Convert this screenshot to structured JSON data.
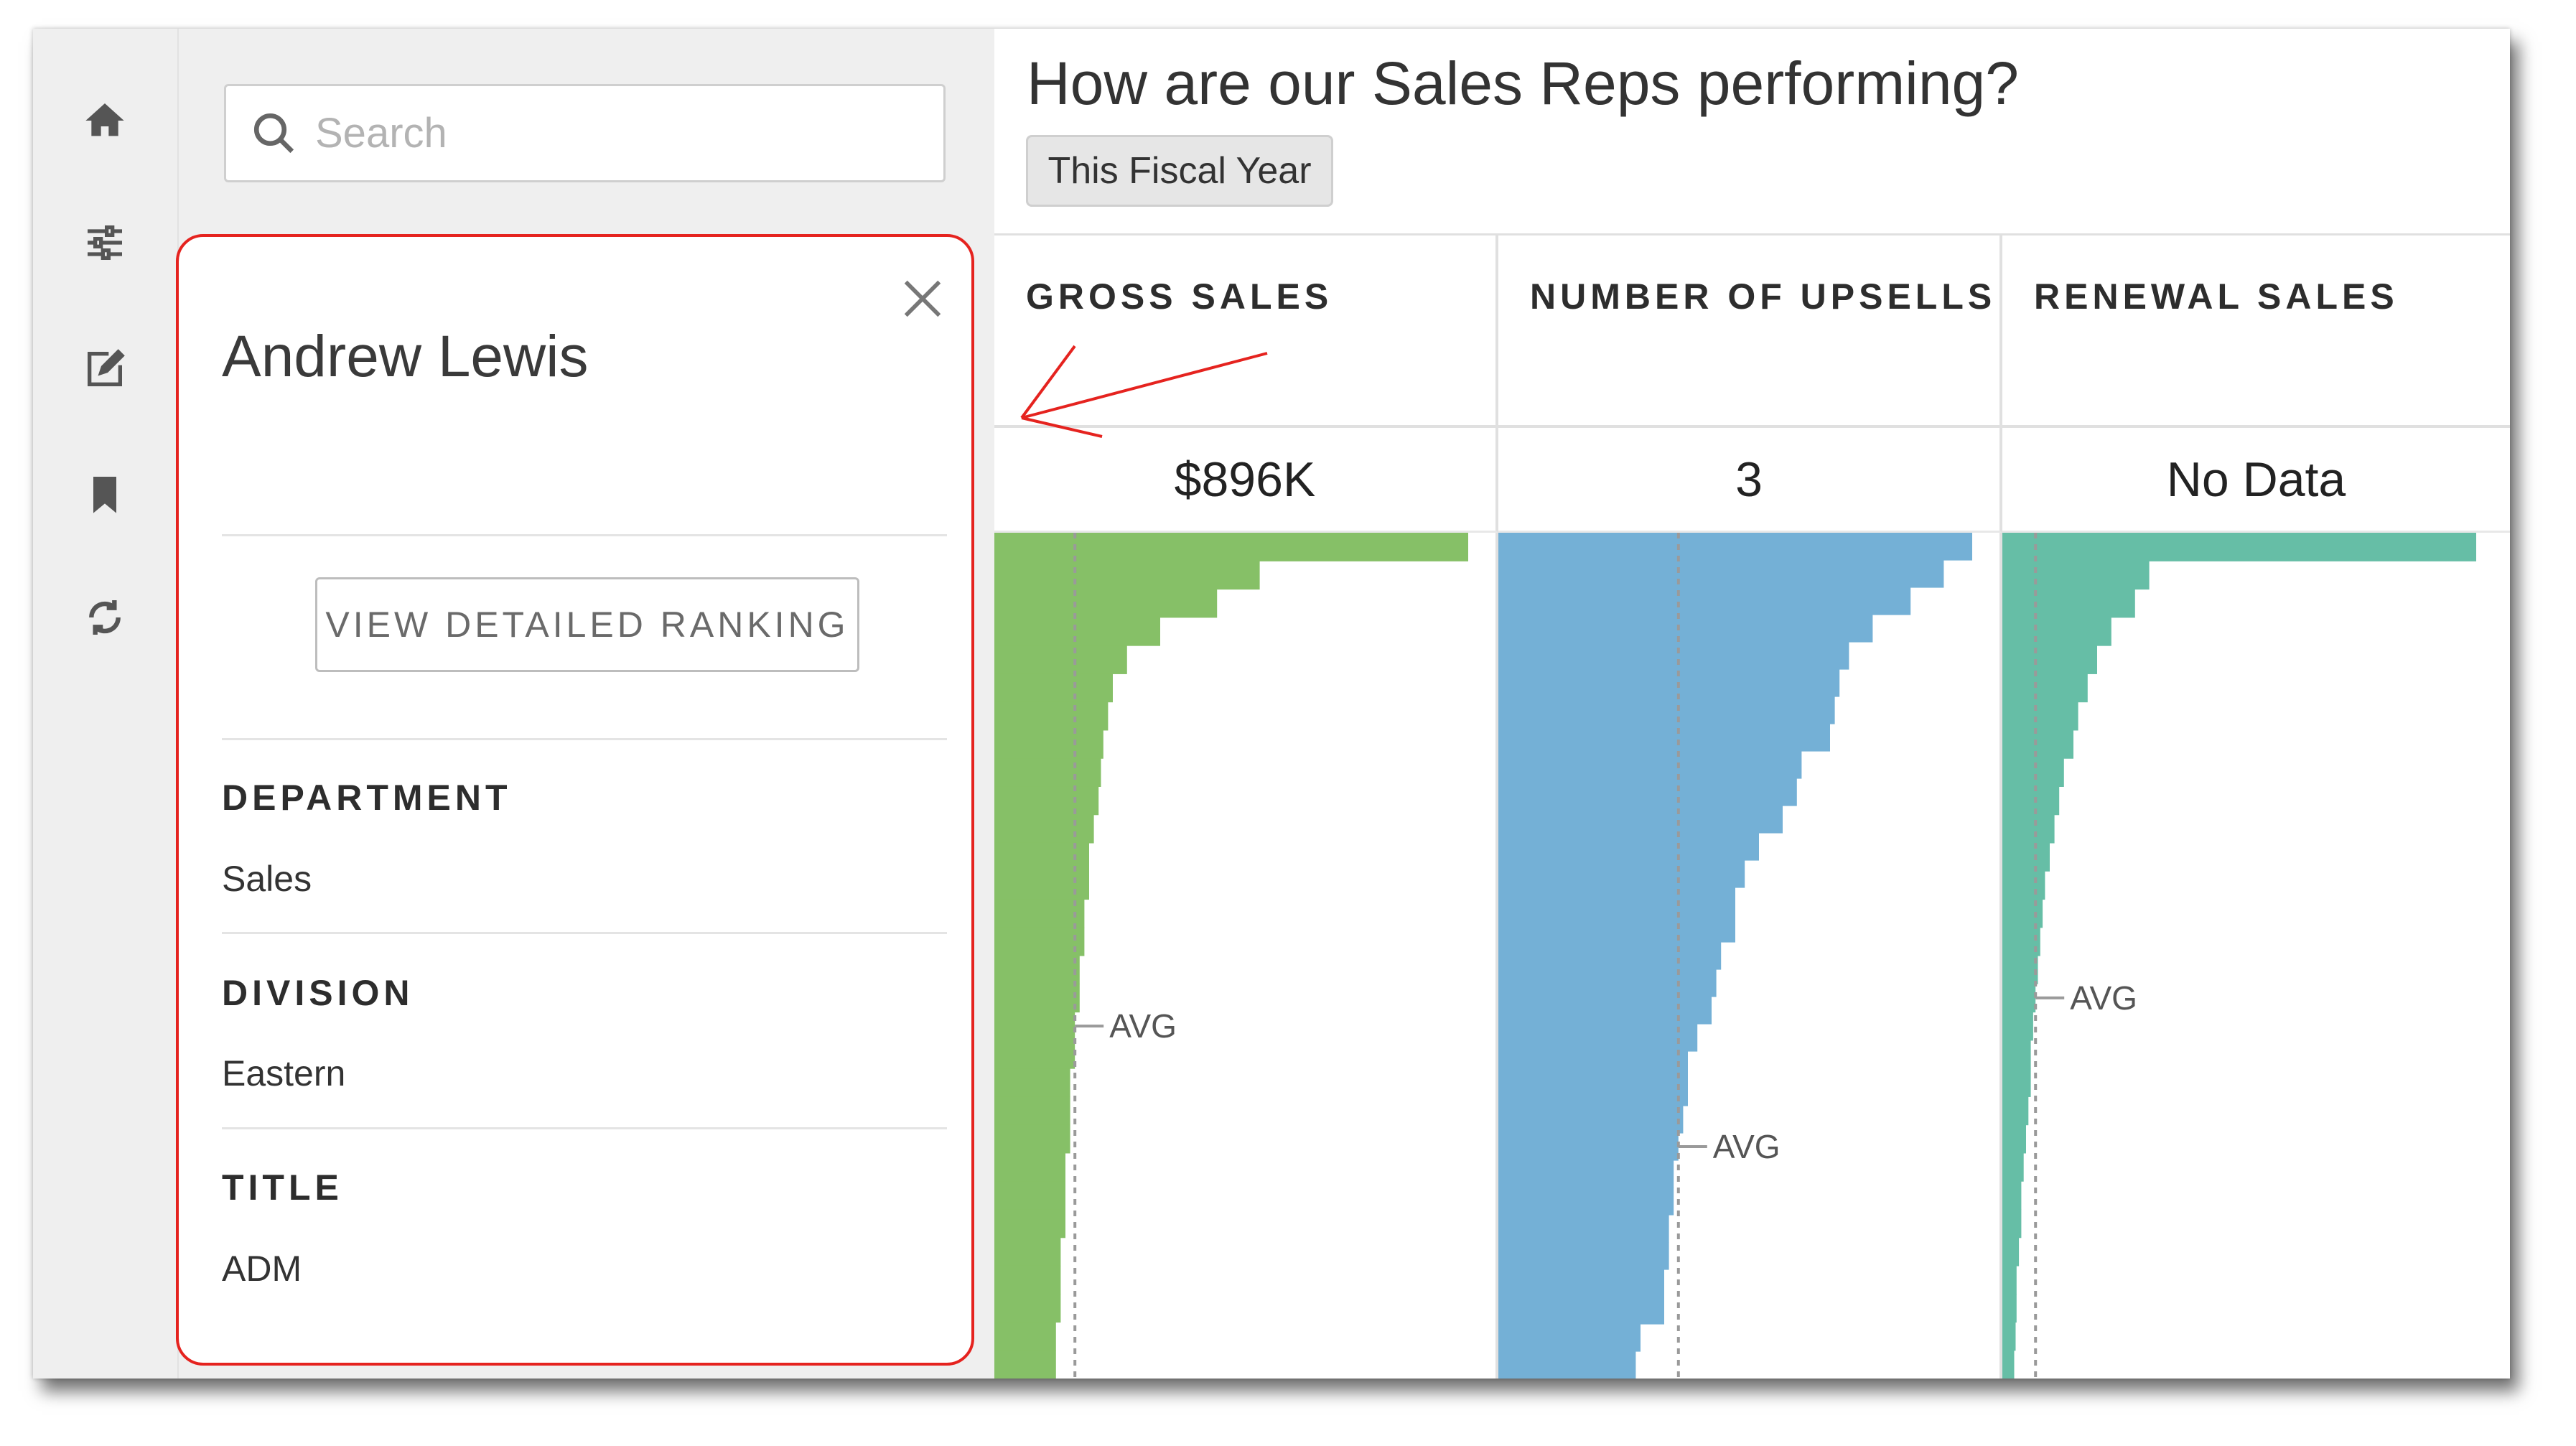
{
  "rail": {
    "icons": [
      "home-icon",
      "sliders-icon",
      "edit-icon",
      "bookmark-icon",
      "refresh-icon"
    ]
  },
  "search": {
    "placeholder": "Search",
    "value": ""
  },
  "detail": {
    "name": "Andrew Lewis",
    "rank_button": "VIEW DETAILED RANKING",
    "fields": [
      {
        "label": "DEPARTMENT",
        "value": "Sales"
      },
      {
        "label": "DIVISION",
        "value": "Eastern"
      },
      {
        "label": "TITLE",
        "value": "ADM"
      }
    ]
  },
  "main": {
    "title": "How are our Sales Reps performing?",
    "filter_chip": "This Fiscal Year"
  },
  "colors": {
    "gross": "#86c067",
    "upsells": "#74b0d6",
    "renewal": "#66bea6",
    "highlight": "#e5231f"
  },
  "chart_data": [
    {
      "type": "bar",
      "title": "GROSS SALES",
      "value_label": "$896K",
      "avg_label": "AVG",
      "values": [
        1.0,
        0.56,
        0.47,
        0.35,
        0.28,
        0.25,
        0.24,
        0.23,
        0.225,
        0.22,
        0.21,
        0.2,
        0.2,
        0.19,
        0.19,
        0.18,
        0.18,
        0.17,
        0.17,
        0.16,
        0.16,
        0.16,
        0.15,
        0.15,
        0.15,
        0.14,
        0.14,
        0.14,
        0.13,
        0.13
      ],
      "avg": 0.17
    },
    {
      "type": "bar",
      "title": "NUMBER OF UPSELLS",
      "value_label": "3",
      "avg_label": "AVG",
      "values": [
        1.0,
        0.94,
        0.87,
        0.79,
        0.74,
        0.72,
        0.71,
        0.7,
        0.64,
        0.63,
        0.6,
        0.55,
        0.52,
        0.5,
        0.5,
        0.47,
        0.46,
        0.45,
        0.42,
        0.4,
        0.4,
        0.39,
        0.38,
        0.37,
        0.37,
        0.36,
        0.36,
        0.35,
        0.35,
        0.3,
        0.29
      ],
      "avg": 0.38
    },
    {
      "type": "bar",
      "title": "RENEWAL SALES",
      "value_label": "No Data",
      "avg_label": "AVG",
      "values": [
        1.0,
        0.31,
        0.28,
        0.23,
        0.2,
        0.18,
        0.16,
        0.15,
        0.13,
        0.12,
        0.11,
        0.1,
        0.09,
        0.085,
        0.08,
        0.075,
        0.07,
        0.065,
        0.06,
        0.06,
        0.055,
        0.05,
        0.045,
        0.04,
        0.04,
        0.035,
        0.03,
        0.03,
        0.028,
        0.025
      ],
      "avg": 0.07
    }
  ]
}
